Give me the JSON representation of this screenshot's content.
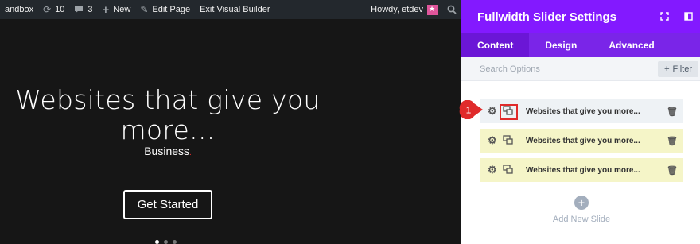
{
  "adminbar": {
    "site_label": "andbox",
    "updates_count": "10",
    "comments_count": "3",
    "new_label": "New",
    "edit_page_label": "Edit Page",
    "exit_builder_label": "Exit Visual Builder",
    "greeting": "Howdy, etdev"
  },
  "slide_preview": {
    "headline_line1": "Websites that give you",
    "headline_line2": "more...",
    "subheading": "Business",
    "cta_label": "Get Started",
    "dots": [
      true,
      false,
      false
    ]
  },
  "panel": {
    "title": "Fullwidth Slider Settings",
    "tabs": [
      {
        "label": "Content",
        "active": true
      },
      {
        "label": "Design",
        "active": false
      },
      {
        "label": "Advanced",
        "active": false
      }
    ],
    "search_placeholder": "Search Options",
    "filter_label": "Filter",
    "slides": [
      {
        "label": "Websites that give you more..."
      },
      {
        "label": "Websites that give you more..."
      },
      {
        "label": "Websites that give you more..."
      }
    ],
    "add_new_label": "Add New Slide"
  },
  "annotation": {
    "step_number": "1",
    "badge_color": "#e02b2b"
  },
  "colors": {
    "panel_header": "#8319ff",
    "panel_tabs": "#7a25e8",
    "admin_bar": "#23282d"
  }
}
